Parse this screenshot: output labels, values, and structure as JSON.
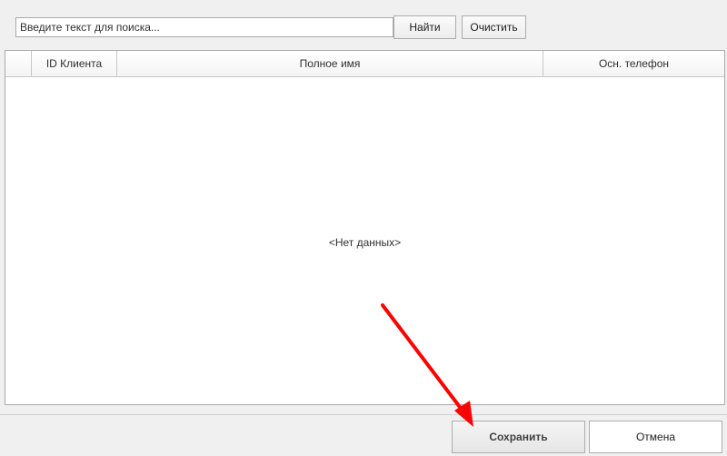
{
  "search": {
    "placeholder": "Введите текст для поиска...",
    "value": "",
    "find_label": "Найти",
    "clear_label": "Очистить"
  },
  "grid": {
    "columns": [
      "",
      "ID Клиента",
      "Полное имя",
      "Осн. телефон"
    ],
    "rows": [],
    "empty_text": "<Нет данных>"
  },
  "footer": {
    "save_label": "Сохранить",
    "cancel_label": "Отмена"
  },
  "annotation": {
    "arrow_color": "#ff0000"
  }
}
